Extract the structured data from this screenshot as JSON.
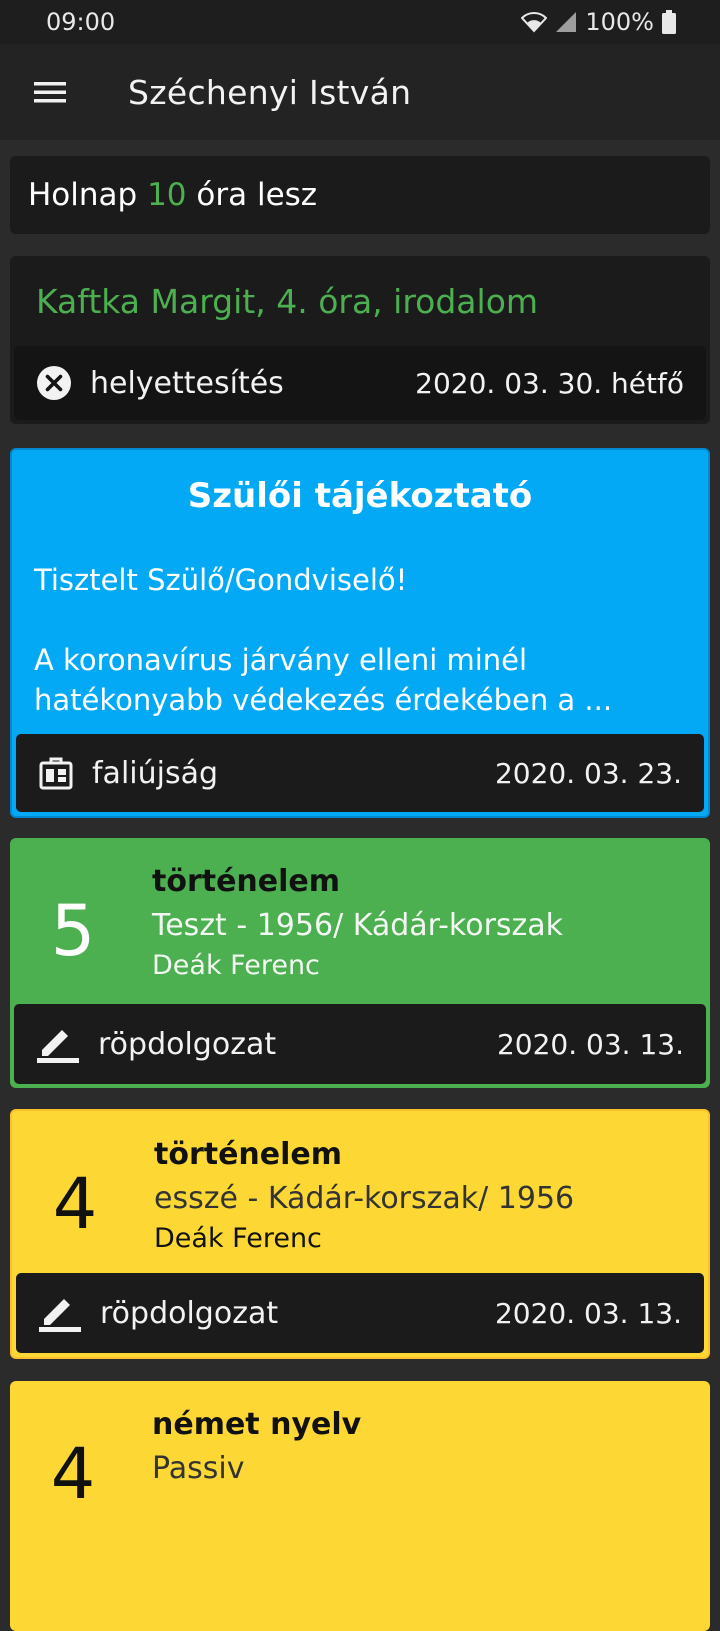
{
  "status_bar": {
    "time": "09:00",
    "battery": "100%"
  },
  "toolbar": {
    "title": "Széchenyi István"
  },
  "tomorrow": {
    "prefix": "Holnap",
    "count": "10",
    "suffix": "óra lesz"
  },
  "substitution": {
    "title": "Kaftka Margit, 4. óra, irodalom",
    "type_label": "helyettesítés",
    "date": "2020. 03. 30. hétfő"
  },
  "notice": {
    "title": "Szülői tájékoztató",
    "greeting": "Tisztelt Szülő/Gondviselő!",
    "excerpt": "A koronavírus járvány elleni minél hatékonyabb védekezés érdekében a ...",
    "source_label": "faliújság",
    "date": "2020. 03. 23."
  },
  "grades": [
    {
      "value": "5",
      "subject": "történelem",
      "description": "Teszt - 1956/ Kádár-korszak",
      "teacher": "Deák Ferenc",
      "type_label": "röpdolgozat",
      "date": "2020. 03. 13.",
      "color": "#4caf50"
    },
    {
      "value": "4",
      "subject": "történelem",
      "description": "esszé - Kádár-korszak/ 1956",
      "teacher": "Deák Ferenc",
      "type_label": "röpdolgozat",
      "date": "2020. 03. 13.",
      "color": "#fdd835"
    },
    {
      "value": "4",
      "subject": "német nyelv",
      "description": "Passiv",
      "color": "#fdd835"
    }
  ],
  "icons": {
    "menu": "hamburger-menu-icon",
    "wifi": "wifi-icon",
    "signal": "cellular-signal-icon",
    "battery": "battery-icon",
    "cancel": "close-circle-icon",
    "board": "bulletin-board-icon",
    "edit": "pencil-icon"
  }
}
